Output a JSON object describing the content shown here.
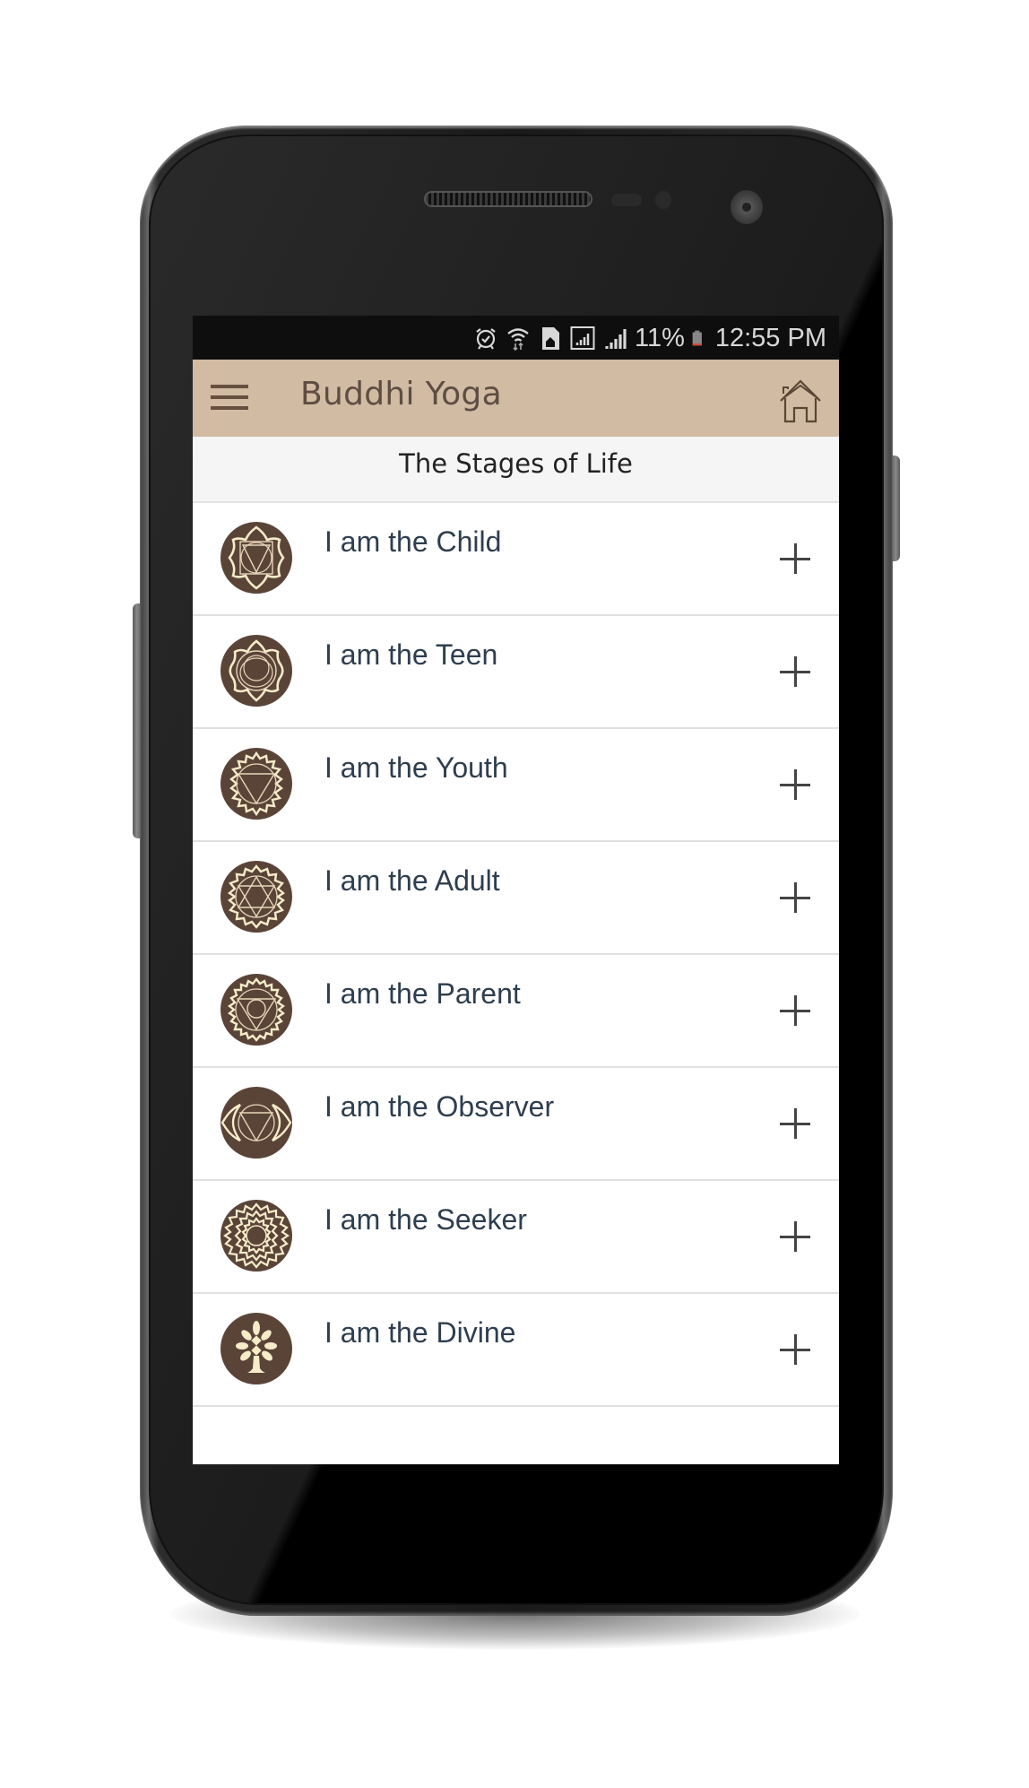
{
  "status_bar": {
    "icons": [
      "alarm-icon",
      "wifi-icon",
      "sim-home-icon",
      "signal-box-icon",
      "signal-icon"
    ],
    "battery_percent": "11%",
    "battery_level": 0.11,
    "time": "12:55 PM"
  },
  "app_bar": {
    "menu_icon": "hamburger-icon",
    "title": "Buddhi Yoga",
    "home_icon": "home-icon"
  },
  "subheader": {
    "title": "The Stages of Life"
  },
  "colors": {
    "app_bar_bg": "#d2bba3",
    "app_bar_fg": "#5e4d42",
    "icon_bg": "#5a4438",
    "icon_fg": "#f5ecc8",
    "row_text": "#2e3e4f"
  },
  "stages": [
    {
      "label": "I am the Child",
      "icon": "root-chakra-icon",
      "action": "expand-plus-icon"
    },
    {
      "label": "I am the Teen",
      "icon": "sacral-chakra-icon",
      "action": "expand-plus-icon"
    },
    {
      "label": "I am the Youth",
      "icon": "solar-plexus-chakra-icon",
      "action": "expand-plus-icon"
    },
    {
      "label": "I am the Adult",
      "icon": "heart-chakra-icon",
      "action": "expand-plus-icon"
    },
    {
      "label": "I am the Parent",
      "icon": "throat-chakra-icon",
      "action": "expand-plus-icon"
    },
    {
      "label": "I am the Observer",
      "icon": "third-eye-chakra-icon",
      "action": "expand-plus-icon"
    },
    {
      "label": "I am the Seeker",
      "icon": "crown-chakra-icon",
      "action": "expand-plus-icon"
    },
    {
      "label": "I am the Divine",
      "icon": "tree-of-life-icon",
      "action": "expand-plus-icon"
    }
  ]
}
